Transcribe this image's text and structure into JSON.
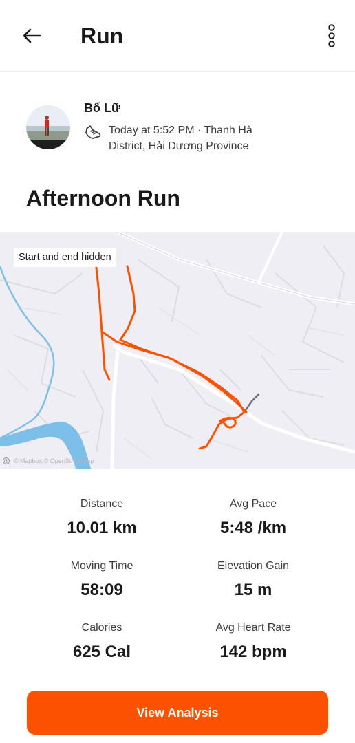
{
  "header": {
    "title": "Run",
    "back_icon": "arrow-left-icon",
    "menu_icon": "more-vertical-icon"
  },
  "athlete": {
    "name": "Bố Lữ",
    "activity_icon": "running-shoe-icon",
    "meta_line1": "Today at 5:52 PM · Thanh Hà",
    "meta_line2": "District, Hải Dương Province"
  },
  "activity": {
    "title": "Afternoon Run"
  },
  "map": {
    "chip_label": "Start and end hidden",
    "attribution": "© Mapbox © OpenStreetMap",
    "route_color": "#fc5200"
  },
  "stats": [
    {
      "label": "Distance",
      "value": "10.01 km"
    },
    {
      "label": "Avg Pace",
      "value": "5:48 /km"
    },
    {
      "label": "Moving Time",
      "value": "58:09"
    },
    {
      "label": "Elevation Gain",
      "value": "15 m"
    },
    {
      "label": "Calories",
      "value": "625 Cal"
    },
    {
      "label": "Avg Heart Rate",
      "value": "142 bpm"
    }
  ],
  "cta": {
    "label": "View Analysis"
  },
  "colors": {
    "accent": "#fc5200",
    "text_primary": "#1a1a1a",
    "text_secondary": "#3c3c3c",
    "map_background": "#eeeef4",
    "river": "#7cc0ea"
  }
}
